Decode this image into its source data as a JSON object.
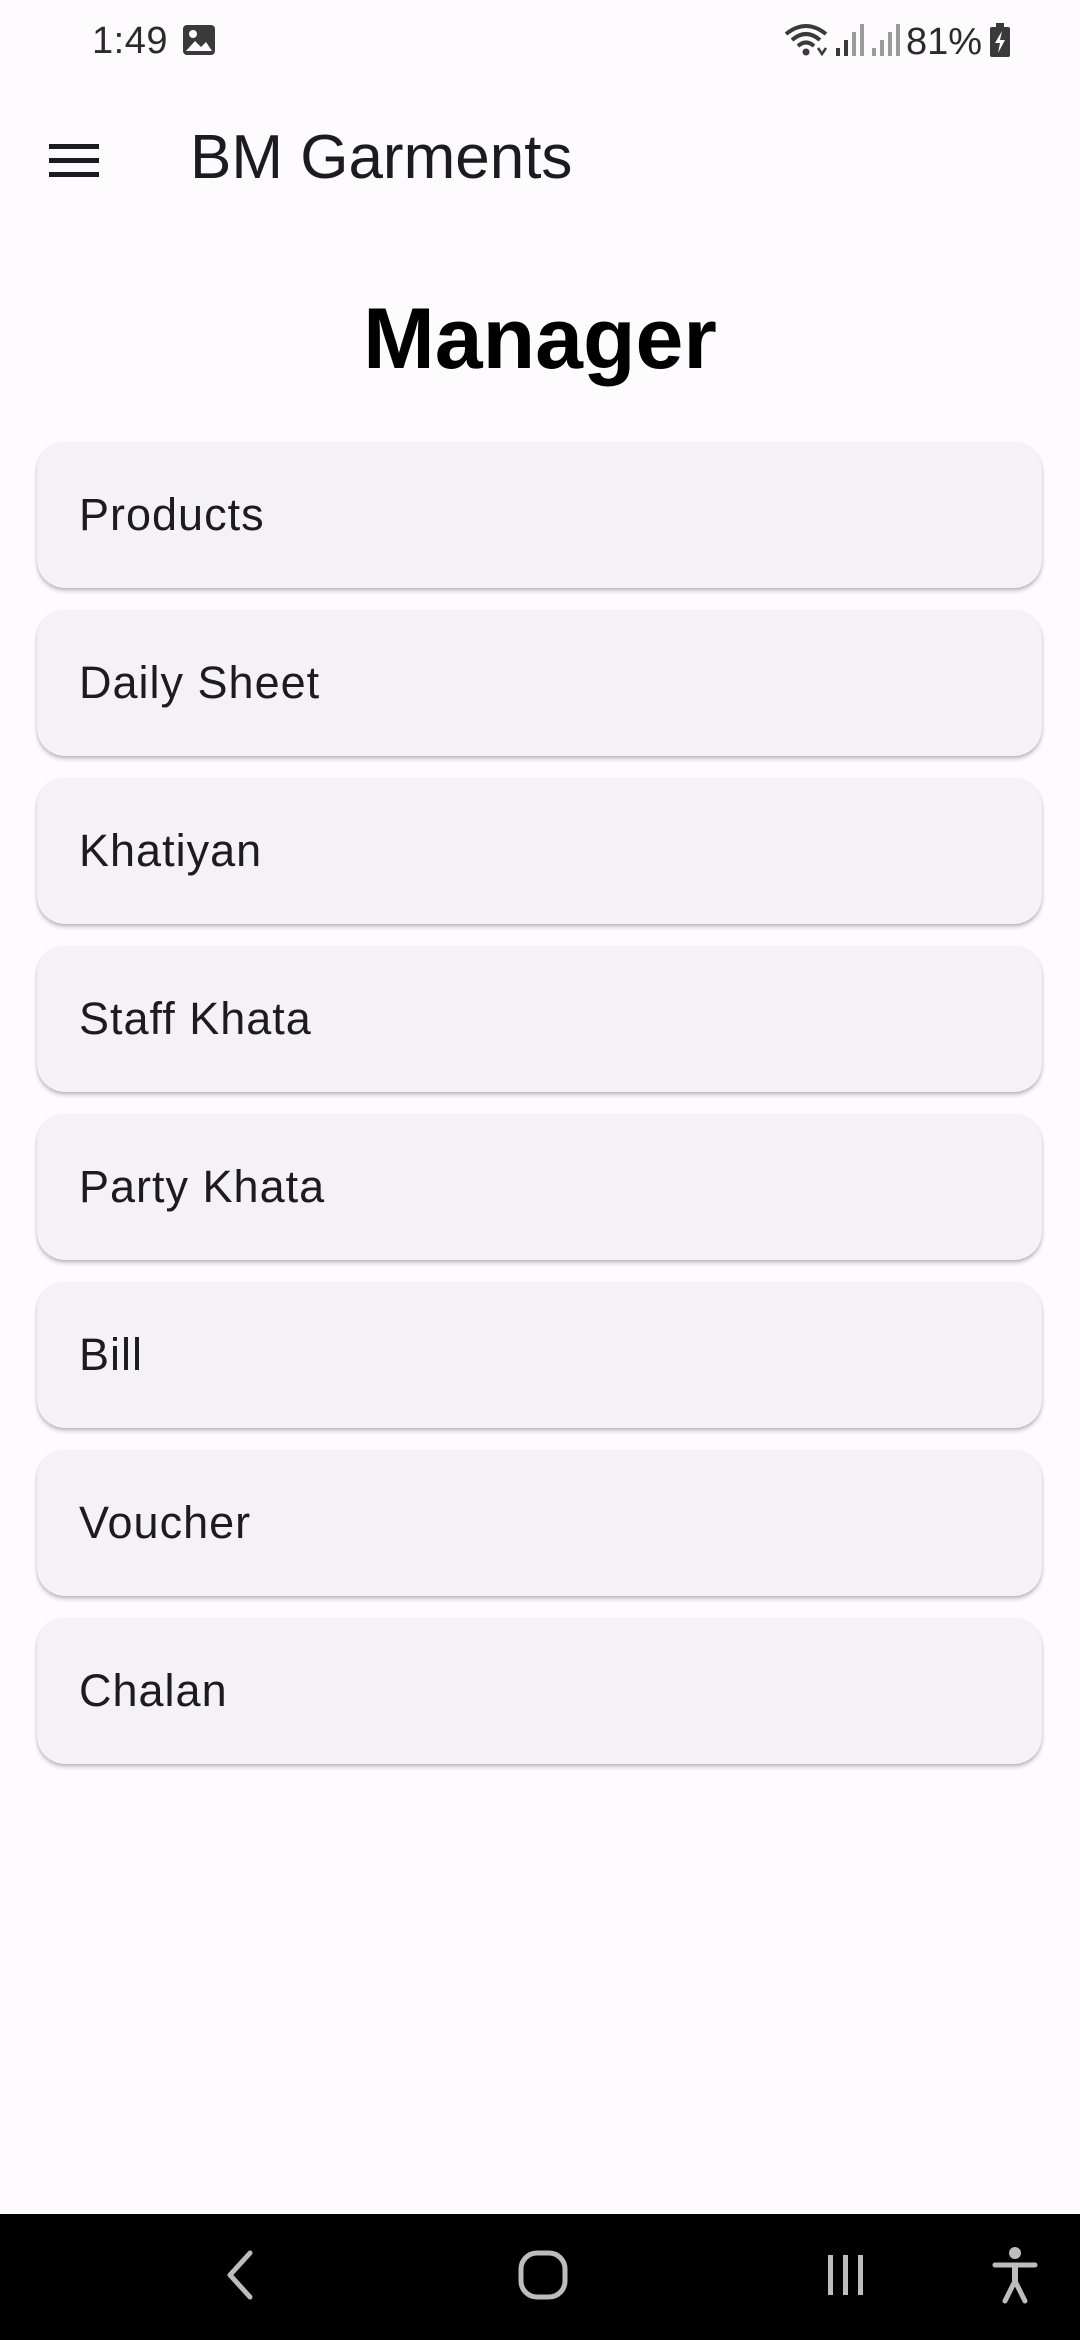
{
  "status_bar": {
    "time": "1:49",
    "battery_percent": "81%"
  },
  "app_bar": {
    "title": "BM Garments"
  },
  "page": {
    "heading": "Manager"
  },
  "menu_items": [
    {
      "label": "Products"
    },
    {
      "label": "Daily Sheet"
    },
    {
      "label": "Khatiyan"
    },
    {
      "label": "Staff Khata"
    },
    {
      "label": "Party Khata"
    },
    {
      "label": "Bill"
    },
    {
      "label": "Voucher"
    },
    {
      "label": "Chalan"
    }
  ],
  "icons": {
    "menu": "hamburger-menu-icon",
    "back": "back-chevron-icon",
    "home": "home-icon",
    "recents": "recents-icon",
    "accessibility": "accessibility-icon"
  },
  "colors": {
    "background": "#fefbff",
    "card": "#f4f1f7",
    "nav_bar": "#000000"
  }
}
